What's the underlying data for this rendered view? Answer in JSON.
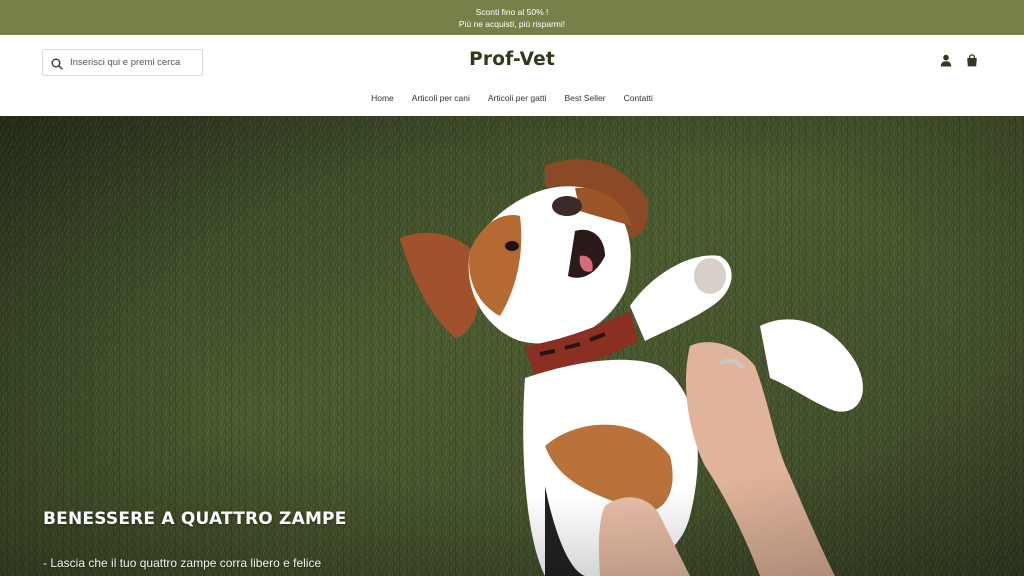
{
  "announcement": {
    "line1": "Sconti fino al 50% !",
    "line2": "Più ne acquisti, più risparmi!"
  },
  "search": {
    "placeholder": "Inserisci qui e premi cerca"
  },
  "brand": {
    "logo": "Prof-Vet",
    "color": "#3c4525"
  },
  "nav": {
    "items": [
      {
        "label": "Home"
      },
      {
        "label": "Articoli per cani"
      },
      {
        "label": "Articoli per gatti"
      },
      {
        "label": "Best Seller"
      },
      {
        "label": "Contatti"
      }
    ]
  },
  "icons": {
    "search": "search-icon",
    "account": "user-icon",
    "cart": "shopping-bag-icon"
  },
  "hero": {
    "title": "BENESSERE A QUATTRO ZAMPE",
    "subtitle": "- Lascia che il tuo quattro zampe corra libero e felice",
    "image": "beagle-puppy-on-grass"
  },
  "colors": {
    "announcement_bg": "#758148",
    "accent": "#3c4525"
  }
}
